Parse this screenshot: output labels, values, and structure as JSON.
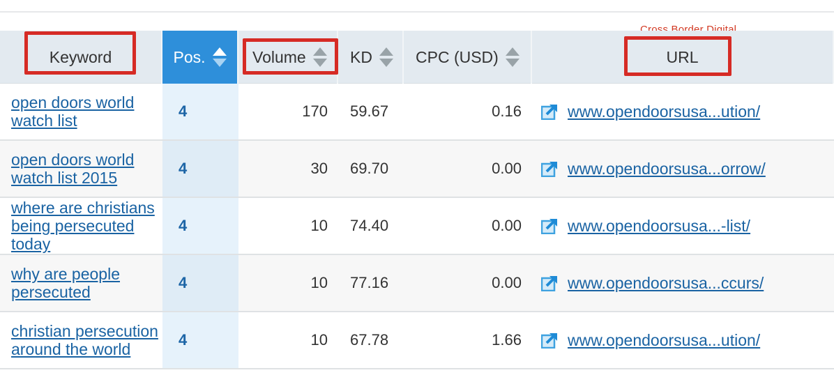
{
  "watermark": "Cross Border Digital",
  "columns": {
    "keyword": "Keyword",
    "pos": "Pos.",
    "volume": "Volume",
    "kd": "KD",
    "cpc": "CPC (USD)",
    "url": "URL"
  },
  "colors": {
    "header_bg": "#e3eaf0",
    "active_sort_bg": "#2e8fda",
    "link": "#1a63a3",
    "highlight_box": "#d62b25"
  },
  "rows": [
    {
      "keyword": "open doors world watch list",
      "pos": "4",
      "volume": "170",
      "kd": "59.67",
      "cpc": "0.16",
      "url": "www.opendoorsusa...ution/"
    },
    {
      "keyword": "open doors world watch list 2015",
      "pos": "4",
      "volume": "30",
      "kd": "69.70",
      "cpc": "0.00",
      "url": "www.opendoorsusa...orrow/"
    },
    {
      "keyword": "where are christians being persecuted today",
      "pos": "4",
      "volume": "10",
      "kd": "74.40",
      "cpc": "0.00",
      "url": "www.opendoorsusa...-list/"
    },
    {
      "keyword": "why are people persecuted",
      "pos": "4",
      "volume": "10",
      "kd": "77.16",
      "cpc": "0.00",
      "url": "www.opendoorsusa...ccurs/"
    },
    {
      "keyword": "christian persecution around the world",
      "pos": "4",
      "volume": "10",
      "kd": "67.78",
      "cpc": "1.66",
      "url": "www.opendoorsusa...ution/"
    }
  ]
}
